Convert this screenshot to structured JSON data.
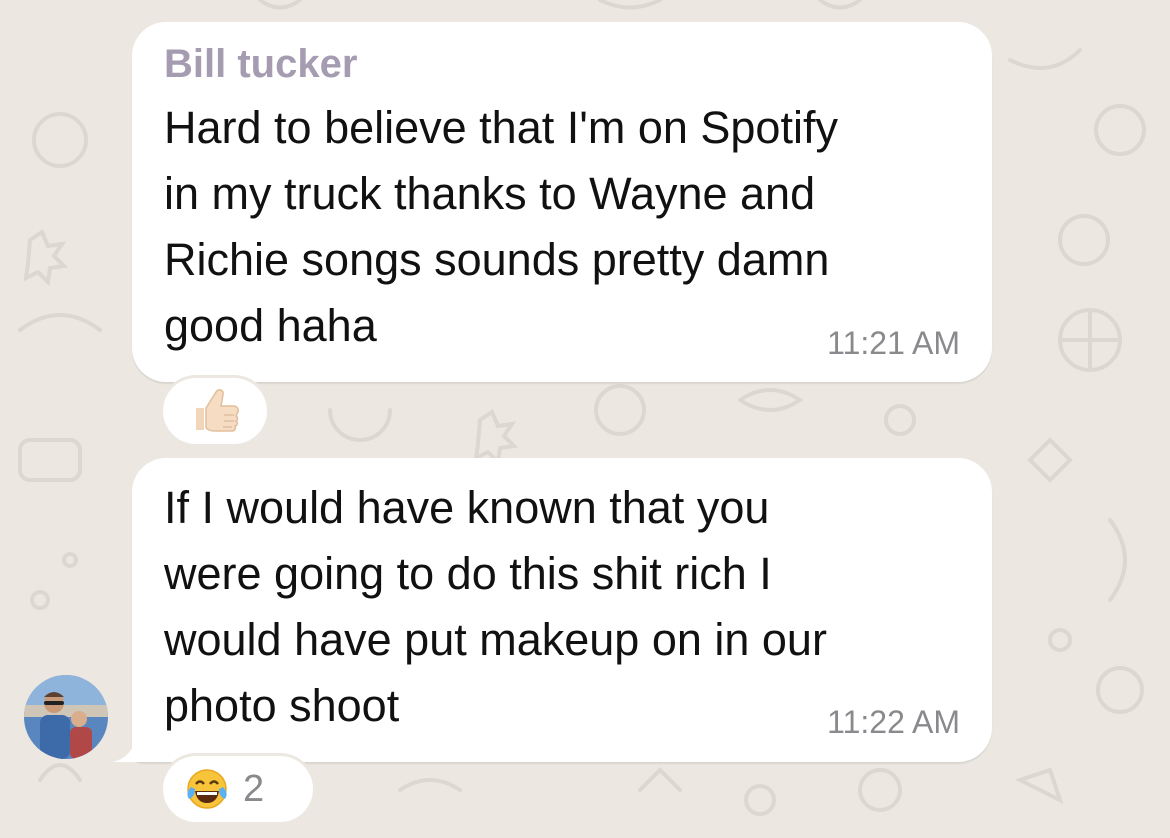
{
  "messages": [
    {
      "sender": "Bill tucker",
      "lines": [
        "Hard to believe that I'm on Spotify",
        "in my truck thanks to Wayne and",
        "Richie songs sounds pretty damn",
        "good haha"
      ],
      "time": "11:21 AM",
      "reaction": {
        "emoji": "thumbs-up",
        "count": ""
      }
    },
    {
      "lines": [
        "If I would have known that you",
        "were going to do this shit rich I",
        "would have put makeup on in our",
        "photo shoot"
      ],
      "time": "11:22 AM",
      "reaction": {
        "emoji": "face-with-tears-of-joy",
        "count": "2"
      }
    }
  ],
  "colors": {
    "background": "#ece8e1",
    "bubble": "#ffffff",
    "sender_name": "#a59cb1",
    "timestamp": "#8a8a8e"
  }
}
